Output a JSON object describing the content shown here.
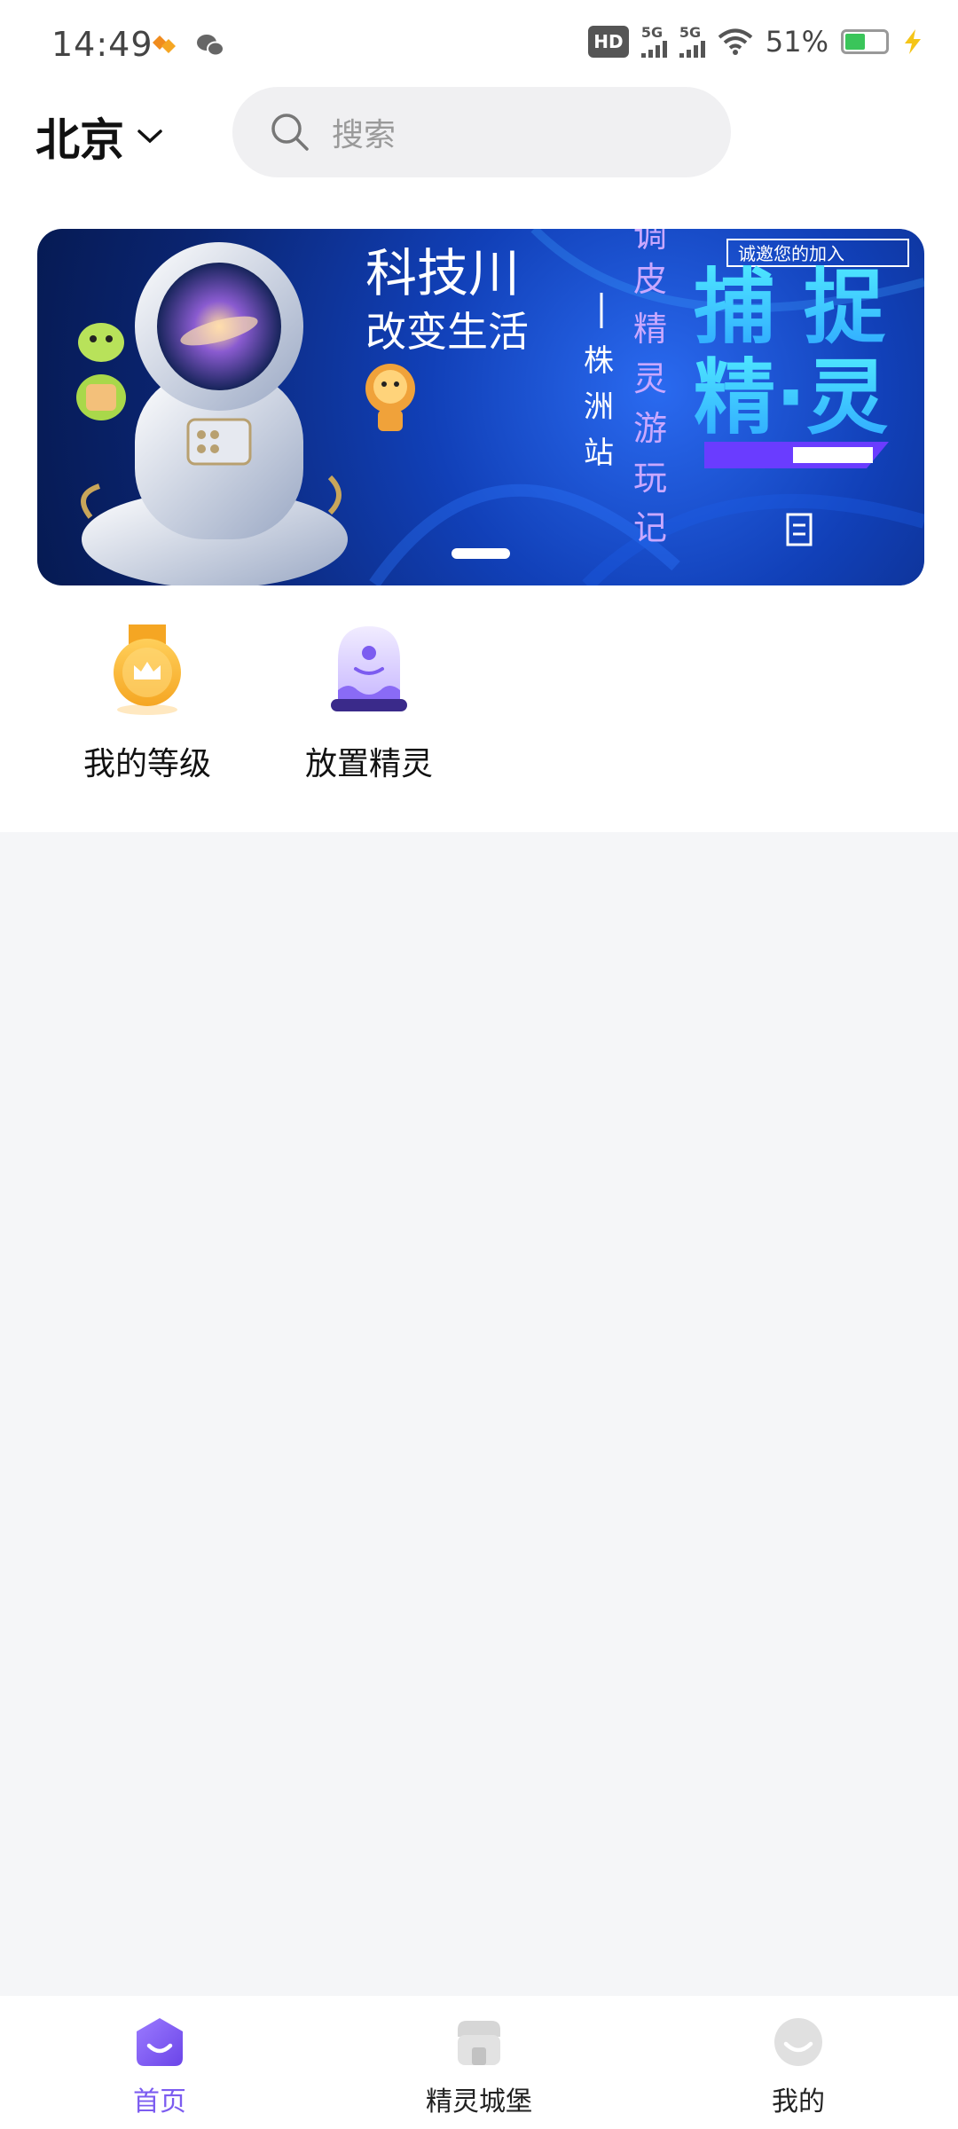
{
  "status_bar": {
    "time": "14:49",
    "hd_label": "HD",
    "net1": "5G",
    "net2": "5G",
    "battery_percent": "51%",
    "battery_level": 0.51,
    "left_icons": [
      "app-notification-icon",
      "wechat-icon"
    ]
  },
  "header": {
    "city": "北京",
    "search_placeholder": "搜索"
  },
  "banner": {
    "title_line1": "科技川",
    "title_line2": "改变生活",
    "station_text": [
      "株",
      "洲",
      "站"
    ],
    "column_text": [
      "调",
      "皮",
      "精",
      "灵",
      "游",
      "玩",
      "记"
    ],
    "invite_text": "诚邀您的加入",
    "headline_top": "捕 捉",
    "headline_bottom": "精·灵",
    "page_index": 1
  },
  "quick_entries": [
    {
      "label": "我的等级",
      "icon": "medal-crown-icon"
    },
    {
      "label": "放置精灵",
      "icon": "spirit-ghost-icon"
    }
  ],
  "bottom_nav": [
    {
      "label": "首页",
      "icon": "home-smile-icon",
      "active": true
    },
    {
      "label": "精灵城堡",
      "icon": "shop-icon",
      "active": false
    },
    {
      "label": "我的",
      "icon": "profile-smile-icon",
      "active": false
    }
  ],
  "colors": {
    "accent": "#7c5cf0",
    "medal": "#f7b23b",
    "background": "#f5f6f8"
  }
}
